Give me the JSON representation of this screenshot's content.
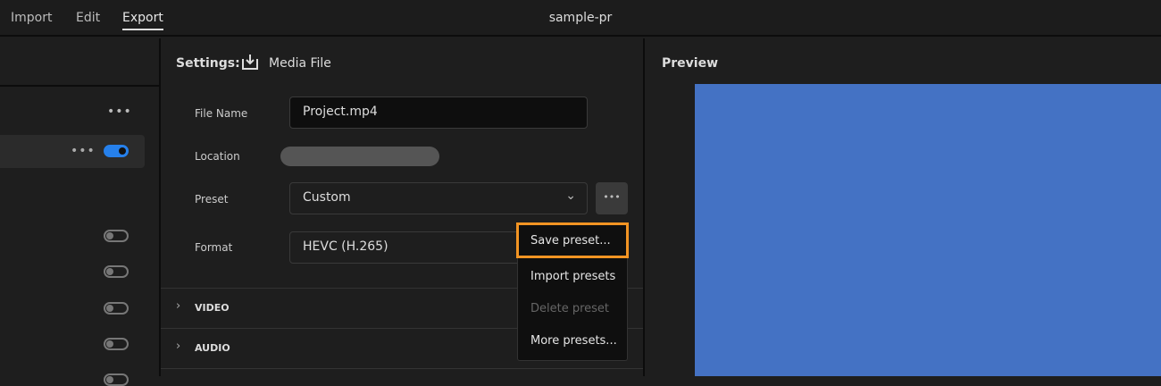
{
  "topbar": {
    "tabs": [
      "Import",
      "Edit",
      "Export"
    ],
    "active": "Export",
    "title": "sample-pr"
  },
  "settings": {
    "heading": "Settings:",
    "target": "Media File",
    "file_name_label": "File Name",
    "file_name": "Project.mp4",
    "location_label": "Location",
    "preset_label": "Preset",
    "preset": "Custom",
    "format_label": "Format",
    "format": "HEVC (H.265)"
  },
  "sections": [
    "VIDEO",
    "AUDIO"
  ],
  "preset_menu": {
    "items": [
      "Save preset...",
      "Import presets",
      "Delete preset",
      "More presets..."
    ]
  },
  "preview": {
    "title": "Preview",
    "color": "#4472c4"
  },
  "left": {
    "main_toggle_on": true
  }
}
